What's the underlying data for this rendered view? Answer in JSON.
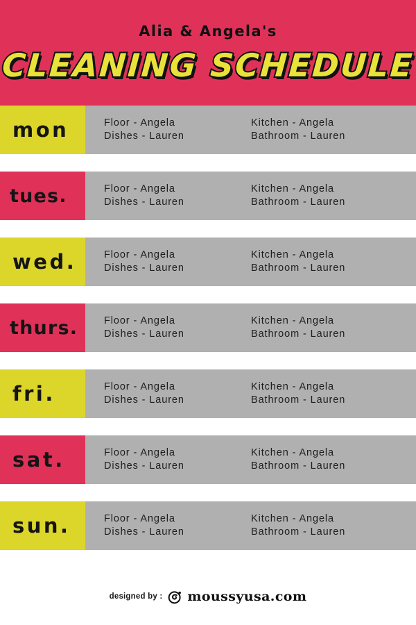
{
  "header": {
    "subtitle": "Alia & Angela's",
    "title": "CLEANING SCHEDULE",
    "bg_color": "#e03259",
    "title_color": "#e8e23a",
    "title_outline_color": "#121212"
  },
  "colors": {
    "yellow": "#dcd62b",
    "red": "#e03259",
    "gray": "#b0b0b0",
    "text": "#1d1d1d"
  },
  "schedule": {
    "rows": [
      {
        "day": "mon",
        "accent": "yellow",
        "col1": [
          "Floor - Angela",
          "Dishes - Lauren"
        ],
        "col2": [
          "Kitchen - Angela",
          "Bathroom - Lauren"
        ]
      },
      {
        "day": "tues.",
        "accent": "red",
        "col1": [
          "Floor - Angela",
          "Dishes - Lauren"
        ],
        "col2": [
          "Kitchen - Angela",
          "Bathroom - Lauren"
        ]
      },
      {
        "day": "wed.",
        "accent": "yellow",
        "col1": [
          "Floor - Angela",
          "Dishes - Lauren"
        ],
        "col2": [
          "Kitchen - Angela",
          "Bathroom - Lauren"
        ]
      },
      {
        "day": "thurs.",
        "accent": "red",
        "col1": [
          "Floor - Angela",
          "Dishes - Lauren"
        ],
        "col2": [
          "Kitchen - Angela",
          "Bathroom - Lauren"
        ]
      },
      {
        "day": "fri.",
        "accent": "yellow",
        "col1": [
          "Floor - Angela",
          "Dishes - Lauren"
        ],
        "col2": [
          "Kitchen - Angela",
          "Bathroom - Lauren"
        ]
      },
      {
        "day": "sat.",
        "accent": "red",
        "col1": [
          "Floor - Angela",
          "Dishes - Lauren"
        ],
        "col2": [
          "Kitchen - Angela",
          "Bathroom - Lauren"
        ]
      },
      {
        "day": "sun.",
        "accent": "yellow",
        "col1": [
          "Floor - Angela",
          "Dishes - Lauren"
        ],
        "col2": [
          "Kitchen - Angela",
          "Bathroom - Lauren"
        ]
      }
    ]
  },
  "footer": {
    "designed_by": "designed by :",
    "logo_icon": "swirl-circle-logo-icon",
    "brand": "moussyusa.com"
  }
}
